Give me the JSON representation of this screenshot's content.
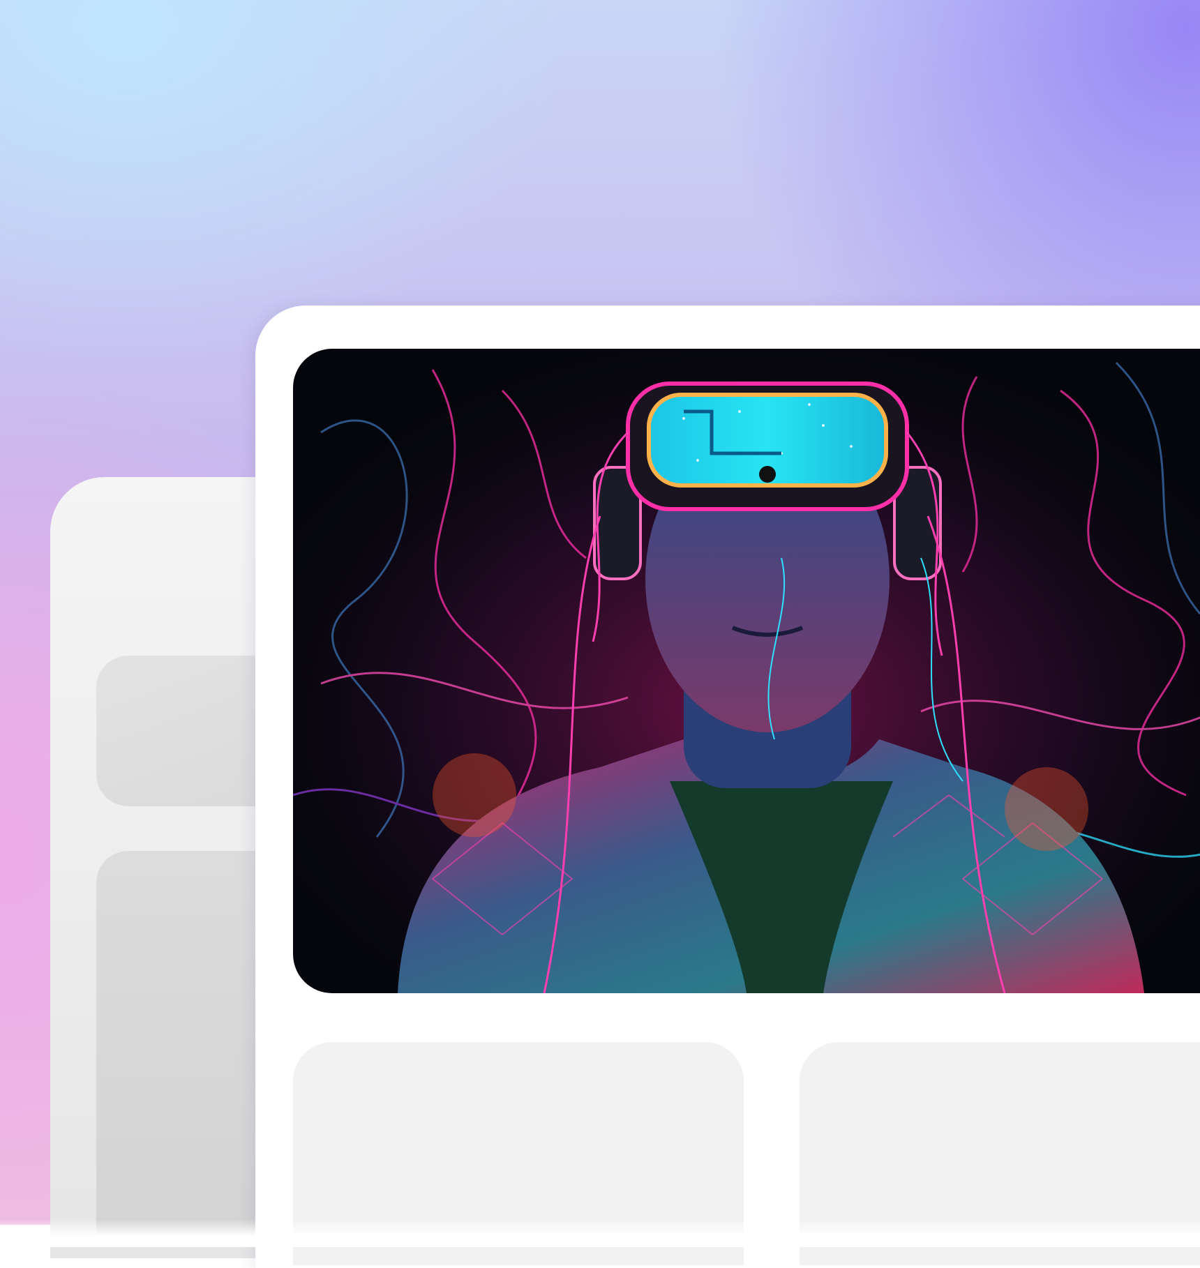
{
  "hero_image": {
    "description_icon": "vr-headset-neon-portrait-image"
  },
  "colors": {
    "accent_pink": "#ff2fa8",
    "accent_cyan": "#2fe0ff",
    "accent_orange": "#ff8a2a"
  }
}
